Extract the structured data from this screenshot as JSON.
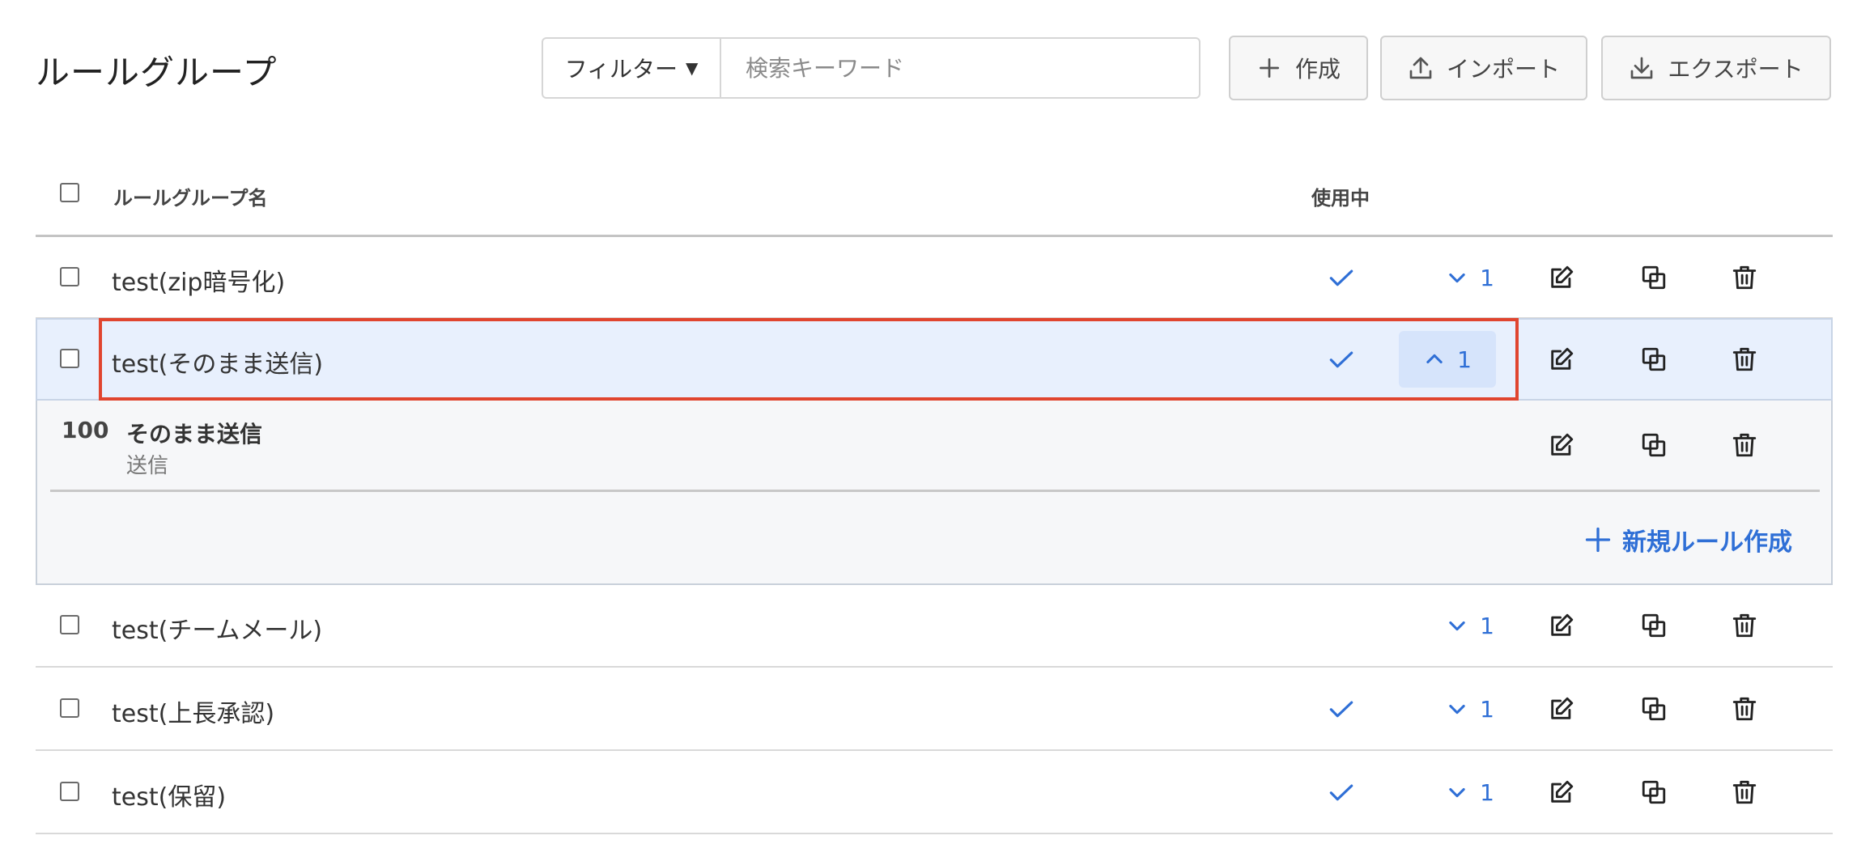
{
  "header": {
    "title": "ルールグループ",
    "filter_label": "フィルター",
    "search_placeholder": "検索キーワード",
    "search_value": "",
    "create_label": "作成",
    "import_label": "インポート",
    "export_label": "エクスポート"
  },
  "table": {
    "columns": {
      "name": "ルールグループ名",
      "in_use": "使用中"
    },
    "rows": [
      {
        "name": "test(zip暗号化)",
        "in_use": true,
        "rule_count": "1",
        "expanded": false
      },
      {
        "name": "test(そのまま送信)",
        "in_use": true,
        "rule_count": "1",
        "expanded": true
      },
      {
        "name": "test(チームメール)",
        "in_use": false,
        "rule_count": "1",
        "expanded": false
      },
      {
        "name": "test(上長承認)",
        "in_use": true,
        "rule_count": "1",
        "expanded": false
      },
      {
        "name": "test(保留)",
        "in_use": true,
        "rule_count": "1",
        "expanded": false
      }
    ]
  },
  "detail": {
    "rule": {
      "order": "100",
      "name": "そのまま送信",
      "action": "送信"
    },
    "new_rule_label": "新規ルール作成"
  },
  "colors": {
    "accent_blue": "#2f6fd6",
    "selected_row_bg": "#e8f0fd",
    "toggle_open_bg": "#d6e4fb",
    "highlight_border": "#e0452f"
  }
}
